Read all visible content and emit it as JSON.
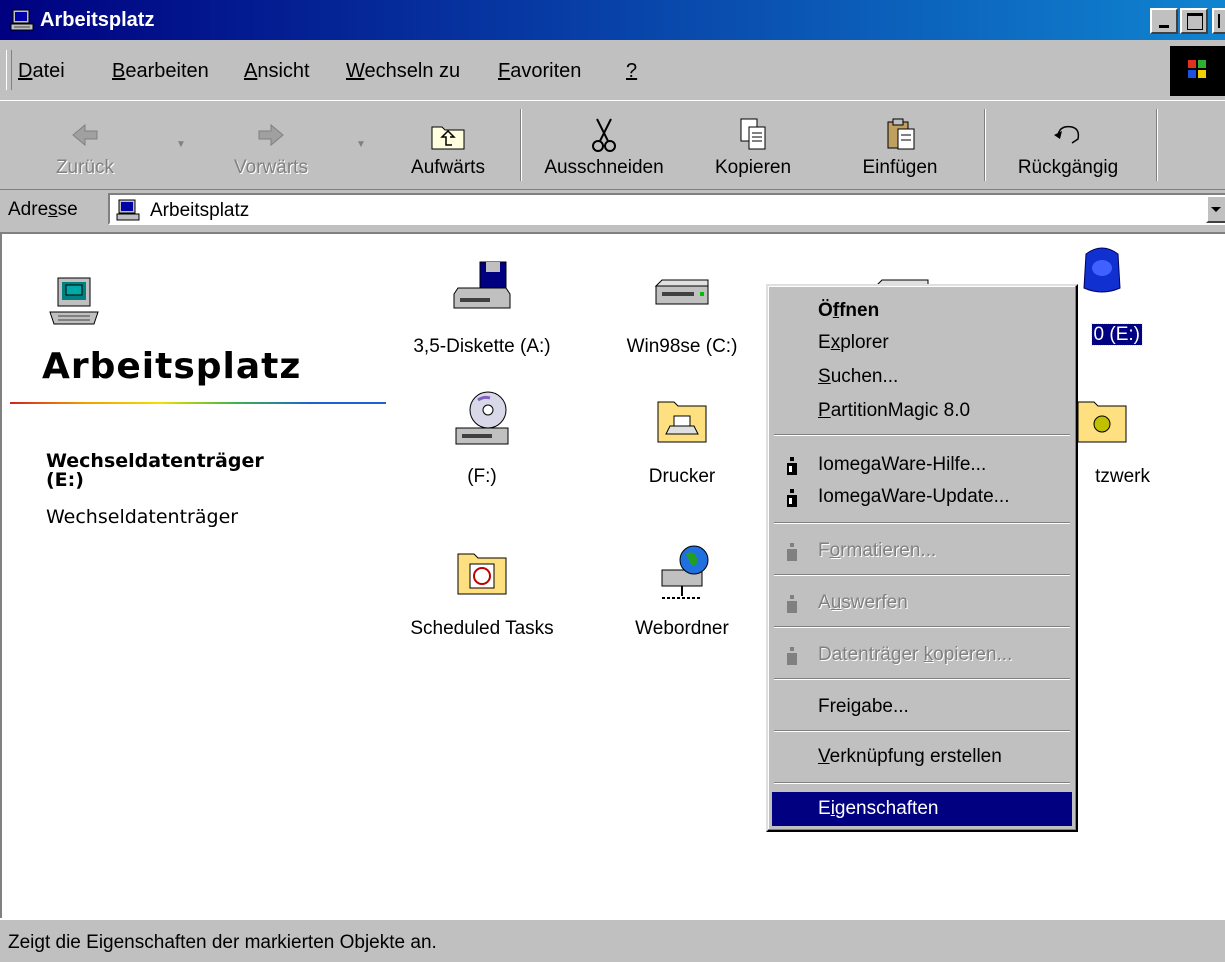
{
  "window": {
    "title": "Arbeitsplatz"
  },
  "menu": {
    "items": [
      {
        "pre": "",
        "key": "D",
        "post": "atei"
      },
      {
        "pre": "",
        "key": "B",
        "post": "earbeiten"
      },
      {
        "pre": "",
        "key": "A",
        "post": "nsicht"
      },
      {
        "pre": "",
        "key": "W",
        "post": "echseln zu"
      },
      {
        "pre": "",
        "key": "F",
        "post": "avoriten"
      },
      {
        "pre": "",
        "key": "?",
        "post": ""
      }
    ]
  },
  "toolbar": {
    "back": "Zurück",
    "forward": "Vorwärts",
    "up": "Aufwärts",
    "cut": "Ausschneiden",
    "copy": "Kopieren",
    "paste": "Einfügen",
    "undo": "Rückgängig"
  },
  "address": {
    "label_pre": "Adre",
    "label_key": "s",
    "label_post": "se",
    "value": "Arbeitsplatz"
  },
  "sidebar": {
    "title": "Arbeitsplatz",
    "selected_name": "Wechseldatenträger",
    "selected_name_line2": "(E:)",
    "selected_type": "Wechseldatenträger"
  },
  "icons": {
    "floppy": "3,5-Diskette (A:)",
    "win98": "Win98se (C:)",
    "zip_partial": "0 (E:)",
    "cdrom": "(F:)",
    "printers": "Drucker",
    "network_partial": "tzwerk",
    "tasks": "Scheduled Tasks",
    "webfolders": "Webordner"
  },
  "context_menu": {
    "open": {
      "pre": "Ö",
      "key": "f",
      "post": "fnen"
    },
    "explorer": {
      "pre": "E",
      "key": "x",
      "post": "plorer"
    },
    "search": {
      "pre": "",
      "key": "S",
      "post": "uchen..."
    },
    "partitionmagic": {
      "pre": "",
      "key": "P",
      "post": "artitionMagic 8.0"
    },
    "iomega_help": "IomegaWare-Hilfe...",
    "iomega_update": "IomegaWare-Update...",
    "format": {
      "pre": "F",
      "key": "o",
      "post": "rmatieren..."
    },
    "eject": {
      "pre": "A",
      "key": "u",
      "post": "swerfen"
    },
    "copy_disk": {
      "pre": "Datenträger ",
      "key": "k",
      "post": "opieren..."
    },
    "share": "Freigabe...",
    "shortcut": {
      "pre": "",
      "key": "V",
      "post": "erknüpfung erstellen"
    },
    "properties": {
      "pre": "E",
      "key": "i",
      "post": "genschaften"
    }
  },
  "status": {
    "text": "Zeigt die Eigenschaften der markierten Objekte an."
  }
}
